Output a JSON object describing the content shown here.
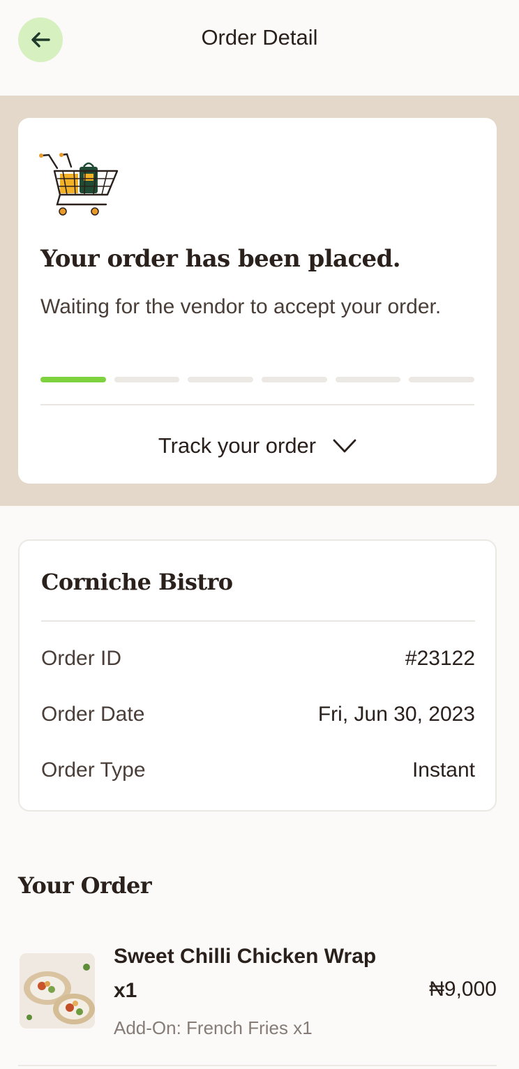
{
  "header": {
    "title": "Order Detail",
    "back_icon": "arrow-left-icon"
  },
  "status": {
    "icon": "shopping-cart-icon",
    "title": "Your order has been placed.",
    "subtitle": "Waiting for the vendor to accept your order.",
    "progress": {
      "completed_steps": 1,
      "total_steps": 6
    },
    "track_label": "Track your order",
    "track_icon": "chevron-down-icon"
  },
  "vendor": {
    "name": "Corniche Bistro",
    "rows": [
      {
        "label": "Order ID",
        "value": "#23122"
      },
      {
        "label": "Order Date",
        "value": "Fri, Jun 30, 2023"
      },
      {
        "label": "Order Type",
        "value": "Instant"
      }
    ]
  },
  "order": {
    "section_title": "Your Order",
    "items": [
      {
        "name": "Sweet Chilli Chicken Wrap x1",
        "addon": "Add-On: French Fries x1",
        "price": "₦9,000"
      }
    ]
  },
  "colors": {
    "accent_green": "#7ed23d",
    "back_button_bg": "#d6f0c0",
    "band_bg": "#e3d8c9",
    "text_dark": "#2a211d"
  }
}
